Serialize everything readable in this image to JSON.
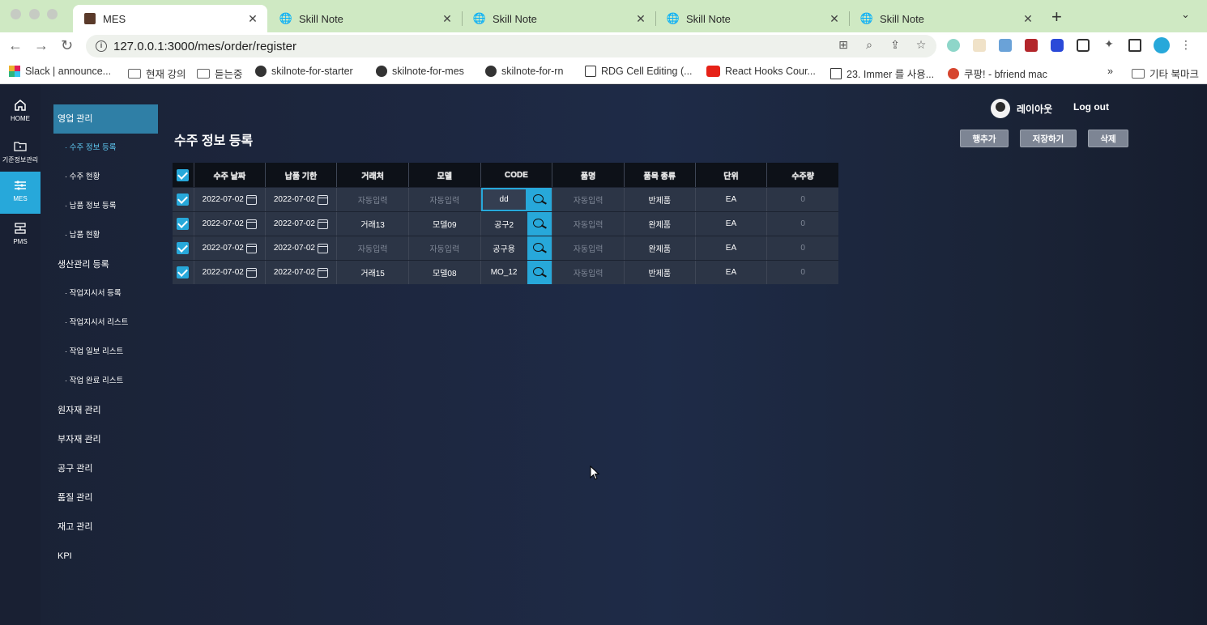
{
  "browser": {
    "tabs": [
      {
        "title": "MES",
        "active": true
      },
      {
        "title": "Skill Note",
        "active": false
      },
      {
        "title": "Skill Note",
        "active": false
      },
      {
        "title": "Skill Note",
        "active": false
      },
      {
        "title": "Skill Note",
        "active": false
      }
    ],
    "url": "127.0.0.1:3000/mes/order/register",
    "bookmarks": [
      "Slack | announce...",
      "현재 강의",
      "듣는중",
      "skilnote-for-starter",
      "skilnote-for-mes",
      "skilnote-for-rn",
      "RDG Cell Editing (...",
      "React Hooks Cour...",
      "23. Immer 를 사용...",
      "쿠팡! - bfriend mac",
      "»",
      "기타 북마크"
    ]
  },
  "rail": {
    "items": [
      {
        "label": "HOME",
        "icon": "home-icon"
      },
      {
        "label": "기준정보관리",
        "icon": "folder-icon"
      },
      {
        "label": "MES",
        "icon": "sliders-icon"
      },
      {
        "label": "PMS",
        "icon": "server-icon"
      }
    ]
  },
  "menu": {
    "items": [
      {
        "label": "영업 관리"
      },
      {
        "label": "· 수주 정보 등록"
      },
      {
        "label": "· 수주 현황"
      },
      {
        "label": "· 납품 정보 등록"
      },
      {
        "label": "· 납품 현황"
      },
      {
        "label": "생산관리 등록"
      },
      {
        "label": "· 작업지시서 등록"
      },
      {
        "label": "· 작업지시서 리스트"
      },
      {
        "label": "· 작업 일보 리스트"
      },
      {
        "label": "· 작업 완료 리스트"
      },
      {
        "label": "원자재 관리"
      },
      {
        "label": "부자재 관리"
      },
      {
        "label": "공구 관리"
      },
      {
        "label": "품질 관리"
      },
      {
        "label": "재고 관리"
      },
      {
        "label": "KPI"
      }
    ]
  },
  "page": {
    "title": "수주 정보 등록",
    "user_name": "레이아웃",
    "logout": "Log out",
    "buttons": {
      "add_row": "행추가",
      "save": "저장하기",
      "delete": "삭제"
    }
  },
  "grid": {
    "headers": [
      "수주 날짜",
      "납품 기한",
      "거래처",
      "모델",
      "CODE",
      "품명",
      "품목 종류",
      "단위",
      "수주량"
    ],
    "rows": [
      {
        "order_date": "2022-07-02",
        "due_date": "2022-07-02",
        "client": "자동입력",
        "model": "자동입력",
        "code": "dd",
        "name": "자동입력",
        "kind": "반제품",
        "unit": "EA",
        "qty": "0",
        "client_ph": true,
        "model_ph": true,
        "editing": true
      },
      {
        "order_date": "2022-07-02",
        "due_date": "2022-07-02",
        "client": "거래13",
        "model": "모델09",
        "code": "공구2",
        "name": "자동입력",
        "kind": "완제품",
        "unit": "EA",
        "qty": "0",
        "client_ph": false,
        "model_ph": false,
        "editing": false
      },
      {
        "order_date": "2022-07-02",
        "due_date": "2022-07-02",
        "client": "자동입력",
        "model": "자동입력",
        "code": "공구용",
        "name": "자동입력",
        "kind": "완제품",
        "unit": "EA",
        "qty": "0",
        "client_ph": true,
        "model_ph": true,
        "editing": false
      },
      {
        "order_date": "2022-07-02",
        "due_date": "2022-07-02",
        "client": "거래15",
        "model": "모델08",
        "code": "MO_12",
        "name": "자동입력",
        "kind": "반제품",
        "unit": "EA",
        "qty": "0",
        "client_ph": false,
        "model_ph": false,
        "editing": false
      }
    ]
  },
  "colors": {
    "accent": "#27a8da",
    "menu_active": "#2f7fa6",
    "background": "#1b2336"
  }
}
